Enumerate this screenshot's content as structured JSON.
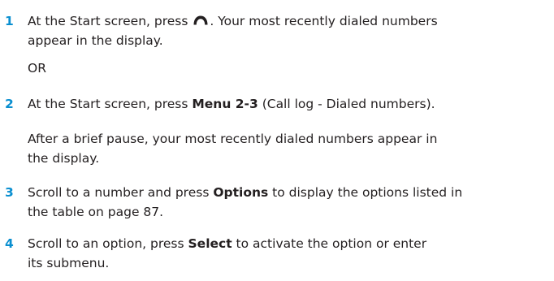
{
  "colors": {
    "step_number": "#0a8fd0",
    "text": "#231f20"
  },
  "steps": [
    {
      "number": "1",
      "line1_pre": "At the Start screen, press ",
      "icon": "end-call-handset-icon",
      "line1_post": ". Your most recently dialed numbers",
      "line2": "appear in the display."
    },
    {
      "number": "2",
      "pre": "At the Start screen, press ",
      "bold": "Menu 2-3",
      "post": " (Call log - Dialed numbers)."
    },
    {
      "number": "3",
      "line1_pre": "Scroll to a number and press ",
      "line1_bold": "Options",
      "line1_post": " to display the options listed in",
      "line2": "the table on page 87."
    },
    {
      "number": "4",
      "line1_pre": "Scroll to an option, press ",
      "line1_bold": "Select",
      "line1_post": " to activate the option or enter",
      "line2": "its submenu."
    }
  ],
  "or_text": "OR",
  "pause_para": {
    "line1": "After a brief pause, your most recently dialed numbers appear in",
    "line2": "the display."
  }
}
